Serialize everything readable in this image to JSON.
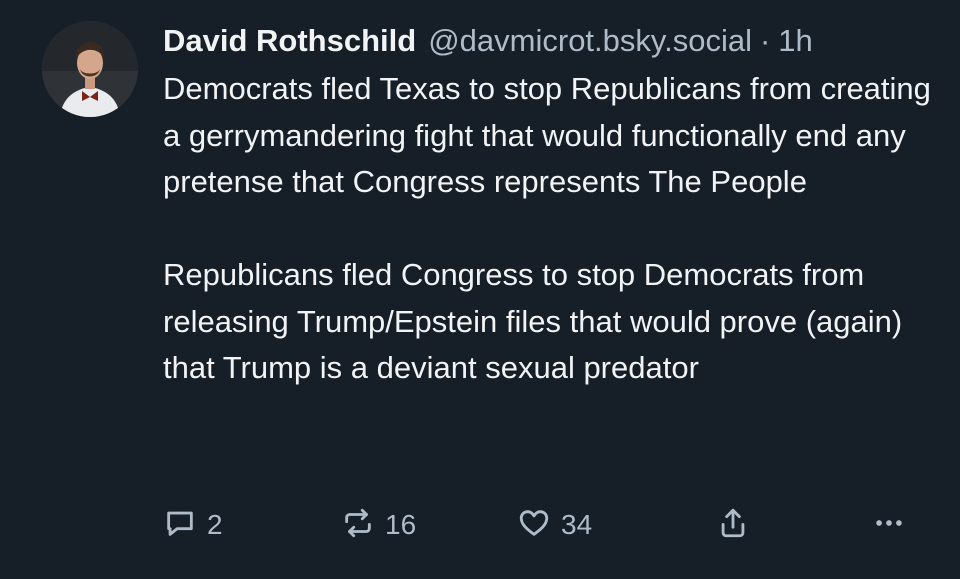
{
  "post": {
    "author_name": "David Rothschild",
    "handle": "@davmicrot.bsky.social",
    "separator": "·",
    "time": "1h",
    "paragraph1": "Democrats fled Texas to stop Republicans from creating a gerrymandering fight that would functionally end any pretense that Congress represents The People",
    "paragraph2": "Republicans fled Congress to stop Democrats from releasing Trump/Epstein files that would prove (again) that Trump is a deviant sexual predator"
  },
  "actions": {
    "reply_count": "2",
    "repost_count": "16",
    "like_count": "34"
  },
  "icons": {
    "reply": "speech-bubble-icon",
    "repost": "repost-arrows-icon",
    "like": "heart-icon",
    "share": "share-upload-icon",
    "more": "ellipsis-icon"
  },
  "colors": {
    "background": "#161e27",
    "text": "#f1f3f5",
    "muted": "#aebbc9"
  }
}
